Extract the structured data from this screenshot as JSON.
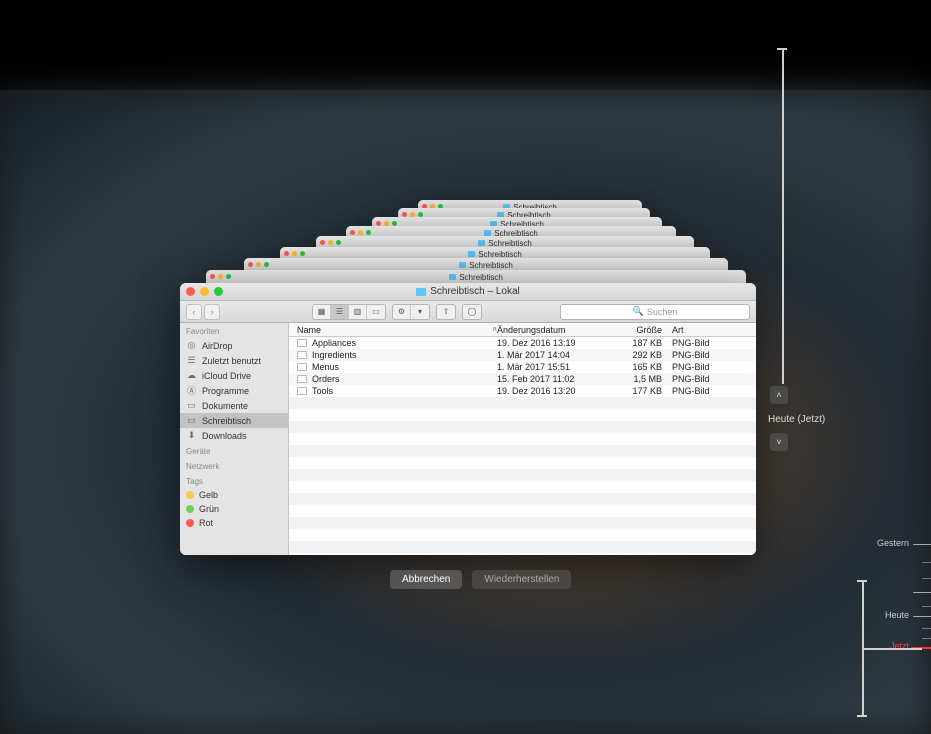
{
  "window": {
    "title": "Schreibtisch – Lokal",
    "stack_label": "Schreibtisch"
  },
  "search": {
    "placeholder": "Suchen"
  },
  "toolbar": {},
  "sidebar": {
    "favorites_hdr": "Favoriten",
    "devices_hdr": "Geräte",
    "network_hdr": "Netzwerk",
    "tags_hdr": "Tags",
    "items": [
      {
        "label": "AirDrop"
      },
      {
        "label": "Zuletzt benutzt"
      },
      {
        "label": "iCloud Drive"
      },
      {
        "label": "Programme"
      },
      {
        "label": "Dokumente"
      },
      {
        "label": "Schreibtisch"
      },
      {
        "label": "Downloads"
      }
    ],
    "tags": [
      {
        "label": "Gelb",
        "color": "#f7c94a"
      },
      {
        "label": "Grün",
        "color": "#6fcf5c"
      },
      {
        "label": "Rot",
        "color": "#ff5a52"
      }
    ]
  },
  "columns": {
    "name": "Name",
    "date": "Änderungsdatum",
    "size": "Größe",
    "kind": "Art"
  },
  "files": [
    {
      "name": "Appliances",
      "date": "19. Dez 2016 13:19",
      "size": "187 KB",
      "kind": "PNG-Bild"
    },
    {
      "name": "Ingredients",
      "date": "1. Mär 2017 14:04",
      "size": "292 KB",
      "kind": "PNG-Bild"
    },
    {
      "name": "Menus",
      "date": "1. Mär 2017 15:51",
      "size": "165 KB",
      "kind": "PNG-Bild"
    },
    {
      "name": "Orders",
      "date": "15. Feb 2017 11:02",
      "size": "1,5 MB",
      "kind": "PNG-Bild"
    },
    {
      "name": "Tools",
      "date": "19. Dez 2016 13:20",
      "size": "177 KB",
      "kind": "PNG-Bild"
    }
  ],
  "buttons": {
    "cancel": "Abbrechen",
    "restore": "Wiederherstellen"
  },
  "timeline": {
    "now_label": "Heute (Jetzt)",
    "yesterday": "Gestern",
    "today": "Heute",
    "now": "Jetzt"
  }
}
